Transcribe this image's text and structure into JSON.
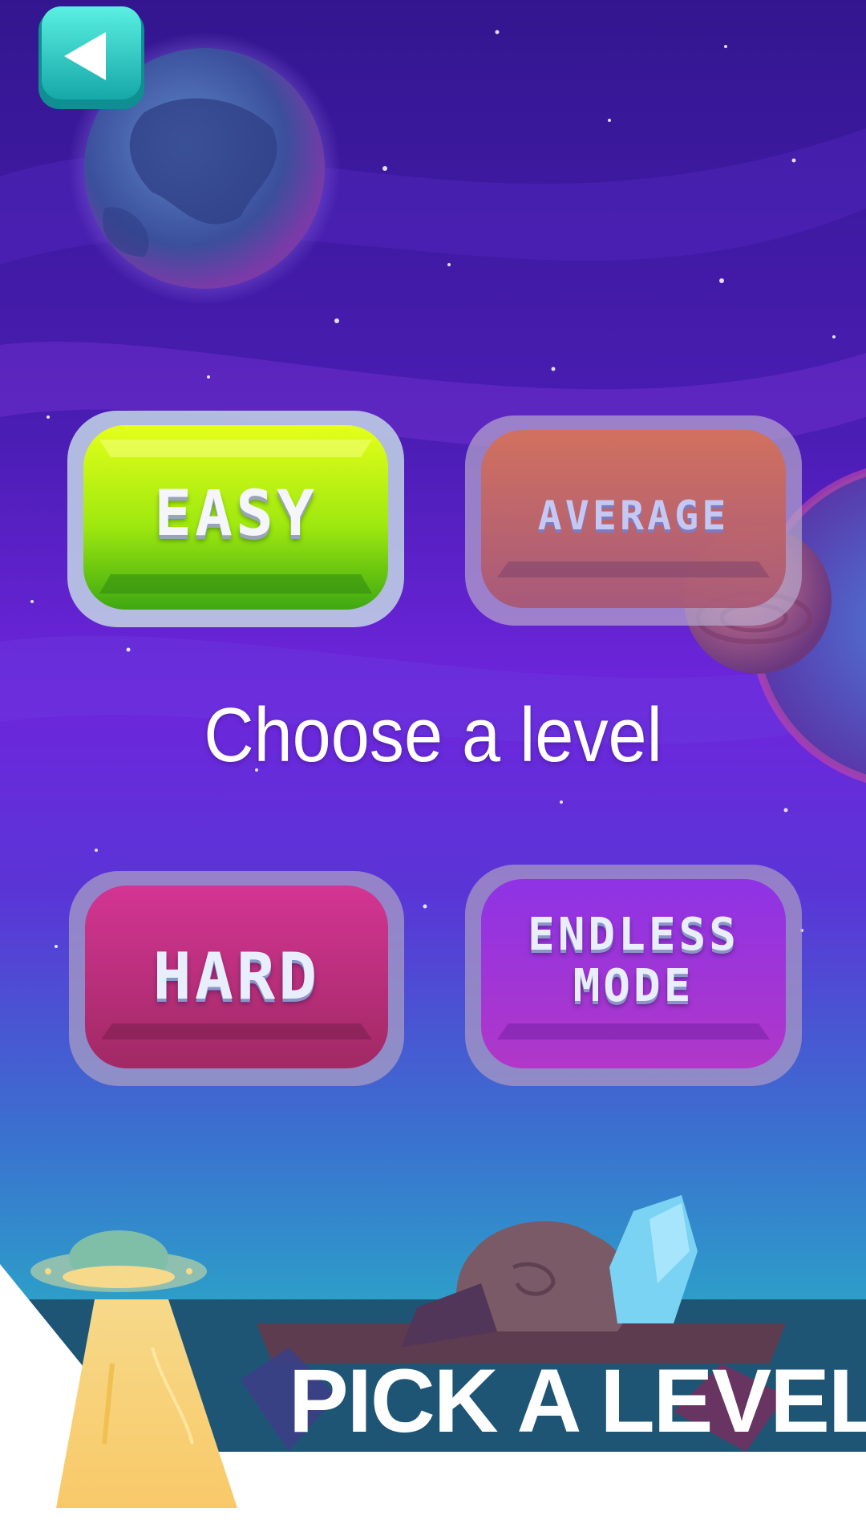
{
  "screen": {
    "prompt": "Choose a level",
    "banner": "PICK A LEVEL"
  },
  "navigation": {
    "back_icon": "back-arrow-icon"
  },
  "levels": [
    {
      "label": "EASY",
      "color": "#8fe40c",
      "state": "active"
    },
    {
      "label": "AVERAGE",
      "color": "#c9674a",
      "state": "dimmed"
    },
    {
      "label": "HARD",
      "color": "#c62d8a",
      "state": "dimmed"
    },
    {
      "label": "ENDLESS\nMODE",
      "color": "#a22fd8",
      "state": "dimmed"
    }
  ],
  "colors": {
    "sky_top": "#3a1a9c",
    "sky_mid": "#6d24d8",
    "sky_bottom": "#2f9cc9",
    "accent_teal": "#2fd1c6",
    "banner_white": "#ffffff"
  }
}
